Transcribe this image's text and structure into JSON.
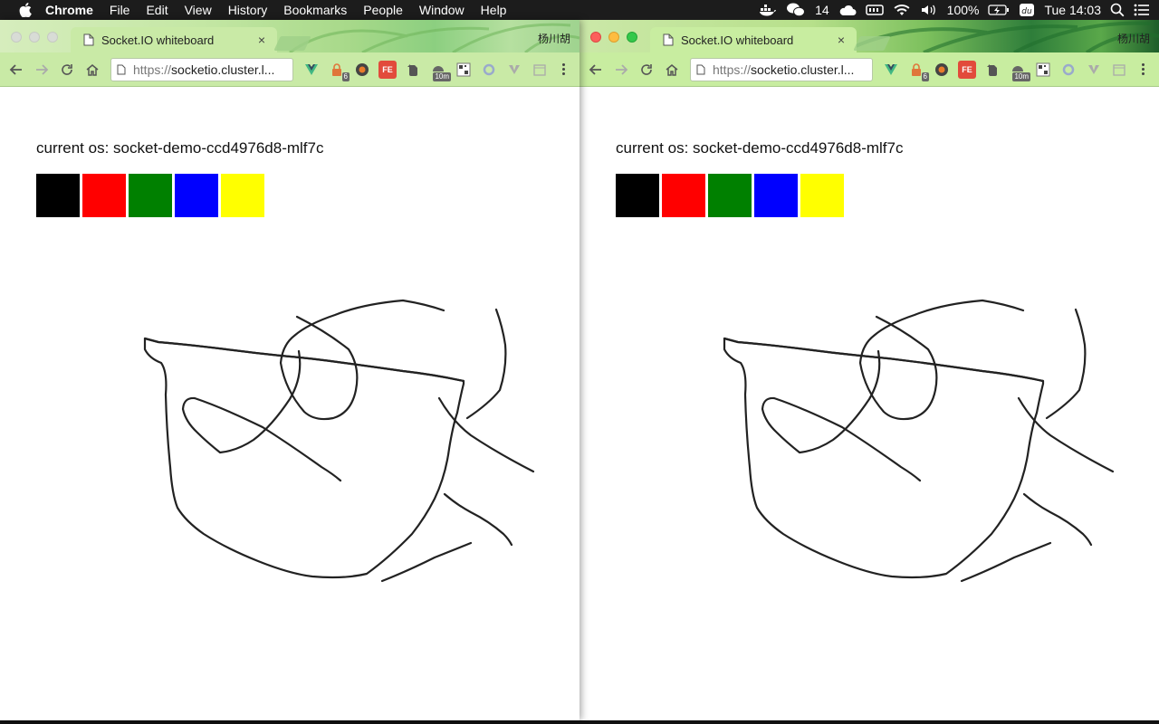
{
  "menubar": {
    "app_name": "Chrome",
    "items": [
      "File",
      "Edit",
      "View",
      "History",
      "Bookmarks",
      "People",
      "Window",
      "Help"
    ],
    "status": {
      "wechat_count": "14",
      "battery": "100%",
      "clock": "Tue 14:03"
    }
  },
  "windows": [
    {
      "tab_title": "Socket.IO whiteboard",
      "tab_close": "×",
      "profile_name": "杨川胡",
      "url_scheme": "https://",
      "url_host": "socketio.cluster.l...",
      "ext_badges": {
        "lock": "6",
        "timer": "10m"
      },
      "ext_labels": {
        "fe": "FE"
      },
      "os_label": "current os: socket-demo-ccd4976d8-mlf7c",
      "colors": [
        "#000000",
        "#ff0000",
        "#008000",
        "#0000ff",
        "#ffff00"
      ]
    },
    {
      "tab_title": "Socket.IO whiteboard",
      "tab_close": "×",
      "profile_name": "杨川胡",
      "url_scheme": "https://",
      "url_host": "socketio.cluster.l...",
      "ext_badges": {
        "lock": "6",
        "timer": "10m"
      },
      "ext_labels": {
        "fe": "FE"
      },
      "os_label": "current os: socket-demo-ccd4976d8-mlf7c",
      "colors": [
        "#000000",
        "#ff0000",
        "#008000",
        "#0000ff",
        "#ffff00"
      ]
    }
  ],
  "stroke_color": "#222222"
}
